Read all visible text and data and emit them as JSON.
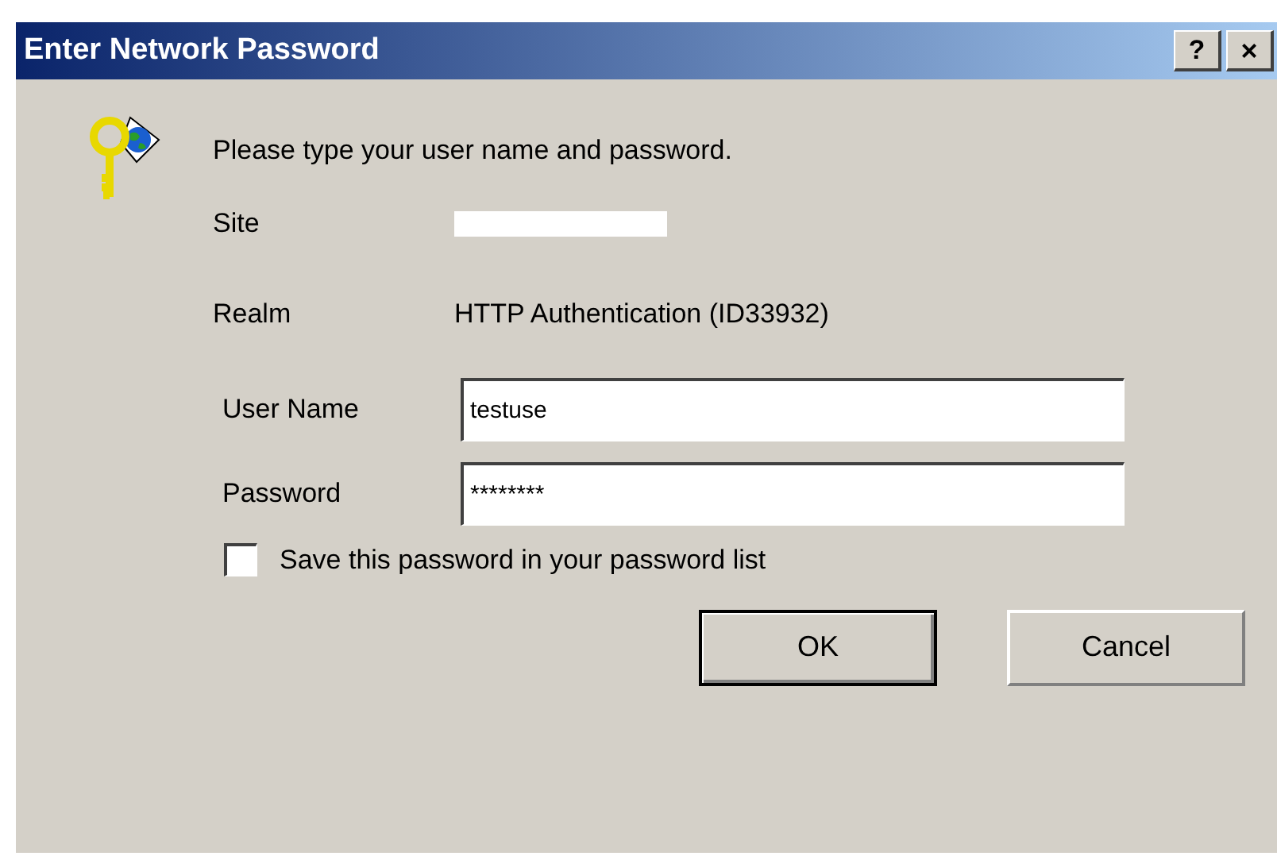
{
  "window": {
    "title": "Enter Network Password",
    "help_button": "?",
    "close_button": "×"
  },
  "prompt": "Please type your user name and password.",
  "site": {
    "label": "Site",
    "redacted": true
  },
  "realm": {
    "label": "Realm",
    "value": "HTTP Authentication (ID33932)"
  },
  "fields": [
    {
      "label": "User Name",
      "value": "testuse"
    },
    {
      "label": "Password",
      "value": "********"
    }
  ],
  "save_password": {
    "label": "Save this password in your password list",
    "checked": false
  },
  "buttons": [
    {
      "label": "OK",
      "default": true
    },
    {
      "label": "Cancel",
      "default": false
    }
  ]
}
